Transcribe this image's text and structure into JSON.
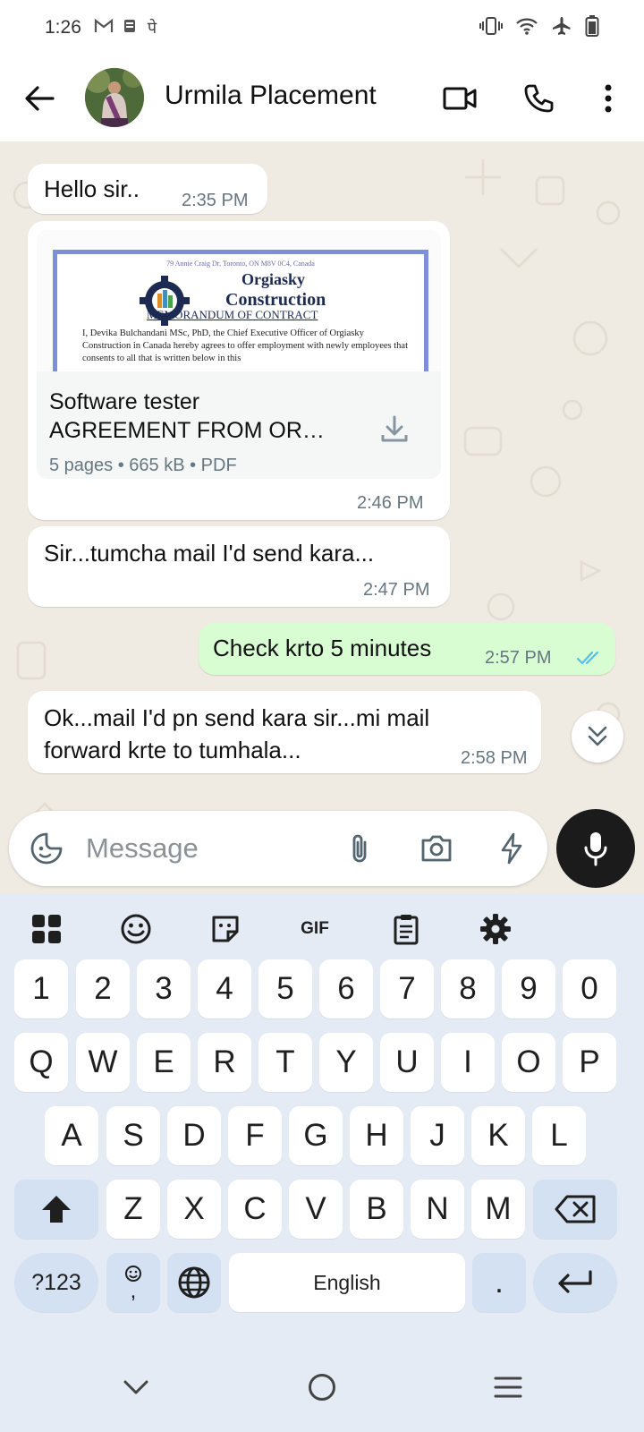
{
  "status_bar": {
    "time": "1:26",
    "left_icons": [
      "gmail-icon",
      "storage-icon",
      "devanagari-pe-icon"
    ],
    "pe_glyph": "पे",
    "right_icons": [
      "vibrate-icon",
      "wifi-icon",
      "airplane-icon",
      "battery-icon"
    ]
  },
  "header": {
    "contact_name": "Urmila Placement",
    "icons": [
      "back-arrow-icon",
      "video-call-icon",
      "phone-icon",
      "more-vert-icon"
    ]
  },
  "messages": [
    {
      "direction": "in",
      "text": "Hello sir..",
      "time": "2:35 PM"
    },
    {
      "direction": "in",
      "type": "document",
      "preview": {
        "address": "79 Annie Craig Dr, Toronto, ON M8V 0C4, Canada",
        "org_line1": "Orgiasky",
        "org_line2": "Construction",
        "memo": "MEMORANDUM OF CONTRACT",
        "body": "I, Devika Bulchandani MSc, PhD, the Chief Executive Officer of Orgiasky Construction in Canada hereby agrees to offer employment with newly employees that consents to all that is written below in this"
      },
      "doc_name": "Software tester\nAGREEMENT FROM OR…",
      "doc_meta": "5 pages • 665 kB • PDF",
      "time": "2:46 PM"
    },
    {
      "direction": "in",
      "text": "Sir...tumcha mail I'd send kara...",
      "time": "2:47 PM"
    },
    {
      "direction": "out",
      "text": "Check krto 5 minutes",
      "time": "2:57 PM",
      "status": "read"
    },
    {
      "direction": "in",
      "text": "Ok...mail I'd pn send kara sir...mi mail\nforward krte to tumhala...",
      "time": "2:58 PM"
    }
  ],
  "composer": {
    "placeholder": "Message",
    "icons": [
      "sticker-emoji-icon",
      "attach-icon",
      "camera-icon",
      "bolt-icon",
      "mic-icon"
    ]
  },
  "keyboard": {
    "toolbar": {
      "gif_label": "GIF",
      "icons": [
        "apps-grid-icon",
        "emoji-icon",
        "sticker-icon",
        "gif-icon",
        "clipboard-icon",
        "settings-icon"
      ]
    },
    "row_numbers": [
      "1",
      "2",
      "3",
      "4",
      "5",
      "6",
      "7",
      "8",
      "9",
      "0"
    ],
    "row_1": [
      "Q",
      "W",
      "E",
      "R",
      "T",
      "Y",
      "U",
      "I",
      "O",
      "P"
    ],
    "row_2": [
      "A",
      "S",
      "D",
      "F",
      "G",
      "H",
      "J",
      "K",
      "L"
    ],
    "row_3": [
      "Z",
      "X",
      "C",
      "V",
      "B",
      "N",
      "M"
    ],
    "bottom": {
      "symbols_label": "?123",
      "comma_label": ",",
      "space_label": "English",
      "period_label": "."
    }
  },
  "nav_bar": {
    "icons": [
      "nav-back-icon",
      "nav-home-icon",
      "nav-recents-icon"
    ]
  },
  "colors": {
    "chat_background": "#efeae2",
    "outgoing_bubble": "#d9fdd3",
    "read_ticks": "#53bdeb",
    "keyboard_background": "#e4ebf5",
    "function_key": "#d3e1f3"
  }
}
